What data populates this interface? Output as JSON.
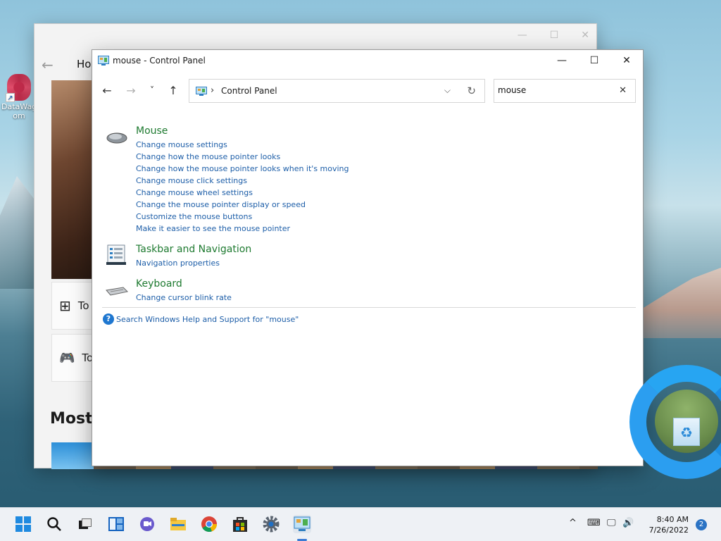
{
  "desktop": {
    "icon_label_line1": "DataWag",
    "icon_label_line2": "om"
  },
  "back_window": {
    "home_tab": "Hor",
    "card1_label": "To",
    "card2_label": "To",
    "section_heading": "Most"
  },
  "window": {
    "title": "mouse - Control Panel",
    "controls": {
      "minimize": "—",
      "maximize": "☐",
      "close": "✕"
    }
  },
  "nav": {
    "back": "←",
    "forward": "→",
    "recent": "˅",
    "up": "↑",
    "breadcrumb_separator": "›",
    "breadcrumb": "Control Panel",
    "address_dropdown": "⌵",
    "refresh": "↻"
  },
  "search": {
    "value": "mouse",
    "clear": "✕"
  },
  "results": [
    {
      "title": "Mouse",
      "icon": "mouse-icon",
      "links": [
        "Change mouse settings",
        "Change how the mouse pointer looks",
        "Change how the mouse pointer looks when it's moving",
        "Change mouse click settings",
        "Change mouse wheel settings",
        "Change the mouse pointer display or speed",
        "Customize the mouse buttons",
        "Make it easier to see the mouse pointer"
      ]
    },
    {
      "title": "Taskbar and Navigation",
      "icon": "taskbar-icon",
      "links": [
        "Navigation properties"
      ]
    },
    {
      "title": "Keyboard",
      "icon": "keyboard-icon",
      "links": [
        "Change cursor blink rate"
      ]
    }
  ],
  "help": {
    "icon_glyph": "?",
    "text": "Search Windows Help and Support for \"mouse\""
  },
  "taskbar": {
    "clock_time": "8:40 AM",
    "clock_date": "7/26/2022",
    "notification_count": "2",
    "tray_chevron": "^"
  },
  "colors": {
    "group_title": "#1e7a30",
    "link": "#1d5ea8",
    "accent": "#2b73c4"
  }
}
